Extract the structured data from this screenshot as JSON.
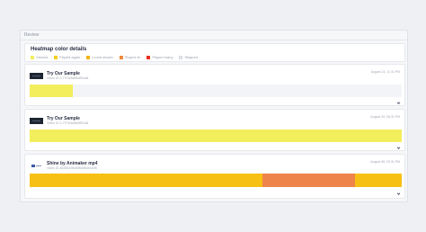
{
  "panel": {
    "title": "Review"
  },
  "legend": {
    "title": "Heatmap color details",
    "items": [
      {
        "label": "Viewed",
        "color": "#f2ee5c"
      },
      {
        "label": "Played again",
        "color": "#f5cf22"
      },
      {
        "label": "Loved shown",
        "color": "#f7b318"
      },
      {
        "label": "Played 4x",
        "color": "#ef8a3a"
      },
      {
        "label": "Played many",
        "color": "#e8301f"
      },
      {
        "label": "Skipped",
        "color": "#e8eaee"
      }
    ]
  },
  "recordings": [
    {
      "title": "Try Our Sample",
      "id": "Video ID 3-77f7d5a8fb8ff2ca8",
      "date": "August 13, 11:31 PM",
      "segments": [
        {
          "start": 0,
          "end": 0.117,
          "color": "#f2ee5c"
        }
      ]
    },
    {
      "title": "Try Our Sample",
      "id": "Video ID 3-77f7d5a8fb8ff2ca8",
      "date": "August 09, 08:31 PM",
      "segments": [
        {
          "start": 0,
          "end": 1,
          "color": "#f2ee5c"
        }
      ]
    },
    {
      "title": "Shine by Animaker mp4",
      "id": "Video ID 4828832f5d6f8c58da44cf6",
      "date": "August 08, 09:31 PM",
      "segments": [
        {
          "start": 0,
          "end": 0.625,
          "color": "#f7c015"
        },
        {
          "start": 0.625,
          "end": 0.875,
          "color": "#ef844b"
        },
        {
          "start": 0.875,
          "end": 1,
          "color": "#f7c015"
        }
      ]
    }
  ]
}
